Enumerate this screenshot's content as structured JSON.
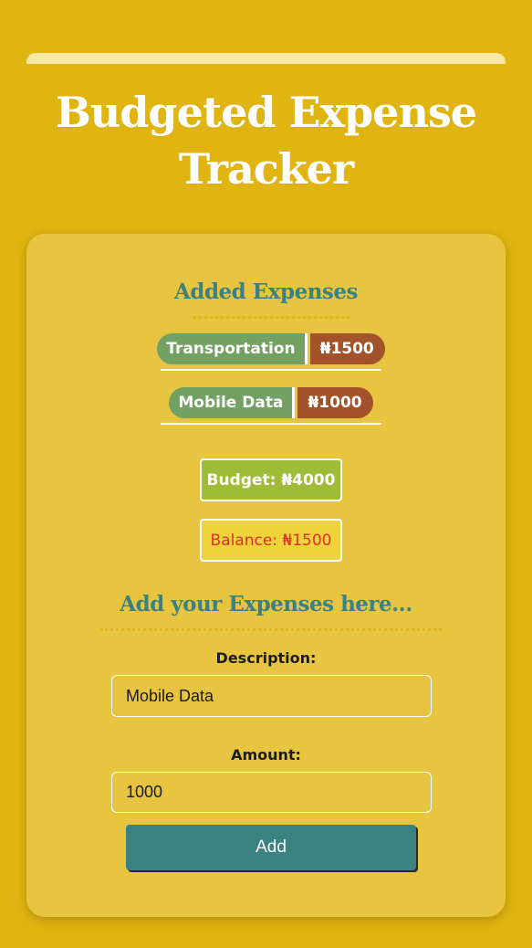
{
  "app": {
    "title": "Budgeted Expense Tracker"
  },
  "expenses": {
    "heading": "Added Expenses",
    "items": [
      {
        "description": "Transportation",
        "amount": "₦1500"
      },
      {
        "description": "Mobile Data",
        "amount": "₦1000"
      }
    ]
  },
  "summary": {
    "budget": "Budget: ₦4000",
    "balance": "Balance: ₦1500"
  },
  "form": {
    "heading": "Add your Expenses here...",
    "description_label": "Description:",
    "description_value": "Mobile Data",
    "amount_label": "Amount:",
    "amount_value": "1000",
    "add_label": "Add"
  },
  "colors": {
    "background": "#e1b511",
    "card": "#e8c540",
    "accent_teal": "#3b8180",
    "desc_pill": "#73a063",
    "amount_pill": "#a2532a",
    "budget_box": "#9dbc37",
    "balance_box": "#eed43a",
    "balance_text": "#e0302a"
  }
}
